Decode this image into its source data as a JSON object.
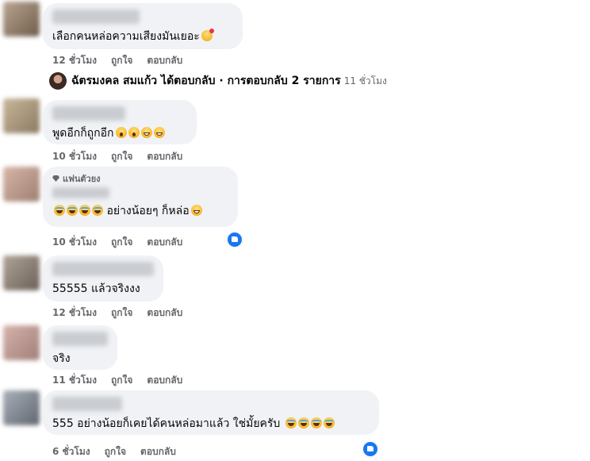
{
  "actions": {
    "like": "ถูกใจ",
    "reply": "ตอบกลับ"
  },
  "reply_summary": {
    "text": "ฉัตรมงคล สมแก้ว ได้ตอบกลับ · การตอบกลับ 2 รายการ",
    "time": "11 ชั่วโมง"
  },
  "comments": [
    {
      "text": "เลือกคนหล่อความเสียงมันเยอะ",
      "time": "12 ชั่วโมง"
    },
    {
      "text": "พูดอีกก็ถูกอีก",
      "time": "10 ชั่วโมง"
    },
    {
      "badge": "แฟนตัวยง",
      "text": "อย่างน้อยๆ ก็หล่อ",
      "time": "10 ชั่วโมง"
    },
    {
      "text": "55555 แล้วจริงงง",
      "time": "12 ชั่วโมง"
    },
    {
      "text": "จริง",
      "time": "11 ชั่วโมง"
    },
    {
      "text": "555 อย่างน้อยก็เคยได้คนหล่อมาแล้ว ใช่มั้ยครับ",
      "time": "6 ชั่วโมง"
    }
  ],
  "colors": {
    "bubble": "#f0f2f5",
    "meta": "#65676b",
    "like_blue": "#1877f2"
  }
}
